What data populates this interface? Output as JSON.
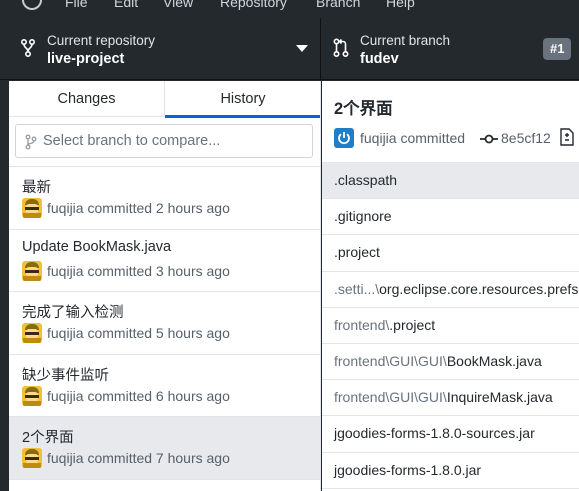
{
  "menubar": {
    "items": [
      "File",
      "Edit",
      "View",
      "Repository",
      "Branch",
      "Help"
    ]
  },
  "toolbar": {
    "repo_label": "Current repository",
    "repo_name": "live-project",
    "branch_label": "Current branch",
    "branch_name": "fudev",
    "pr_badge": "#1"
  },
  "sidebar": {
    "tabs": [
      {
        "label": "Changes"
      },
      {
        "label": "History"
      }
    ],
    "compare_placeholder": "Select branch to compare...",
    "commits": [
      {
        "title": "最新",
        "meta": "fuqijia committed 2 hours ago"
      },
      {
        "title": "Update BookMask.java",
        "meta": "fuqijia committed 3 hours ago"
      },
      {
        "title": "完成了输入检测",
        "meta": "fuqijia committed 5 hours ago"
      },
      {
        "title": "缺少事件监听",
        "meta": "fuqijia committed 6 hours ago"
      },
      {
        "title": "2个界面",
        "meta": "fuqijia committed 7 hours ago"
      }
    ]
  },
  "commit_detail": {
    "summary": "2个界面",
    "author": "fuqijia committed",
    "sha": "8e5cf12",
    "files": [
      {
        "dir": "",
        "name": ".classpath"
      },
      {
        "dir": "",
        "name": ".gitignore"
      },
      {
        "dir": "",
        "name": ".project"
      },
      {
        "dir": ".setti...\\",
        "name": "org.eclipse.core.resources.prefs"
      },
      {
        "dir": "frontend\\",
        "name": ".project"
      },
      {
        "dir": "frontend\\GUI\\GUI\\",
        "name": "BookMask.java"
      },
      {
        "dir": "frontend\\GUI\\GUI\\",
        "name": "InquireMask.java"
      },
      {
        "dir": "",
        "name": "jgoodies-forms-1.8.0-sources.jar"
      },
      {
        "dir": "",
        "name": "jgoodies-forms-1.8.0.jar"
      }
    ]
  },
  "colors": {
    "toolbar_bg": "#24292e",
    "selected_bg": "#e7e9ec",
    "tab_underline": "#0366d6",
    "badge_bg": "#6a737d"
  }
}
